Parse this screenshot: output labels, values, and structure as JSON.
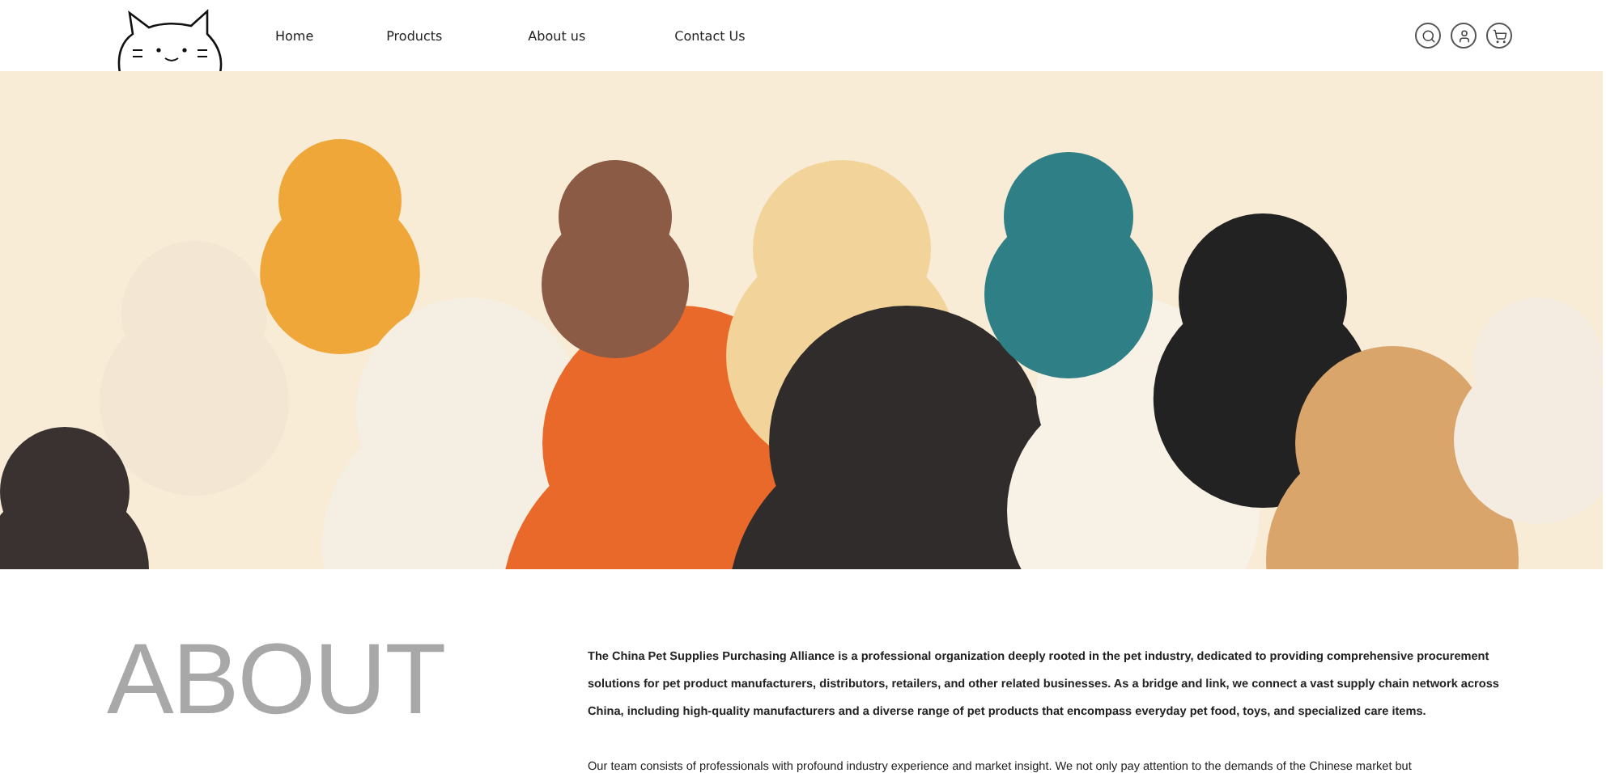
{
  "nav": {
    "items": [
      {
        "label": "Home"
      },
      {
        "label": "Products"
      },
      {
        "label": "About us"
      },
      {
        "label": "Contact Us"
      }
    ]
  },
  "about": {
    "heading": "ABOUT",
    "paragraphs": [
      "The China Pet Supplies Purchasing Alliance is a professional organization deeply rooted in the pet industry, dedicated to providing comprehensive procurement solutions for pet product manufacturers, distributors, retailers, and other related businesses. As a bridge and link, we connect a vast supply chain network across China, including high-quality manufacturers and a diverse range of pet products that encompass everyday pet food, toys, and specialized care items.",
      "Our team consists of professionals with profound industry experience and market insight. We not only pay attention to the demands of the Chinese market but"
    ]
  }
}
